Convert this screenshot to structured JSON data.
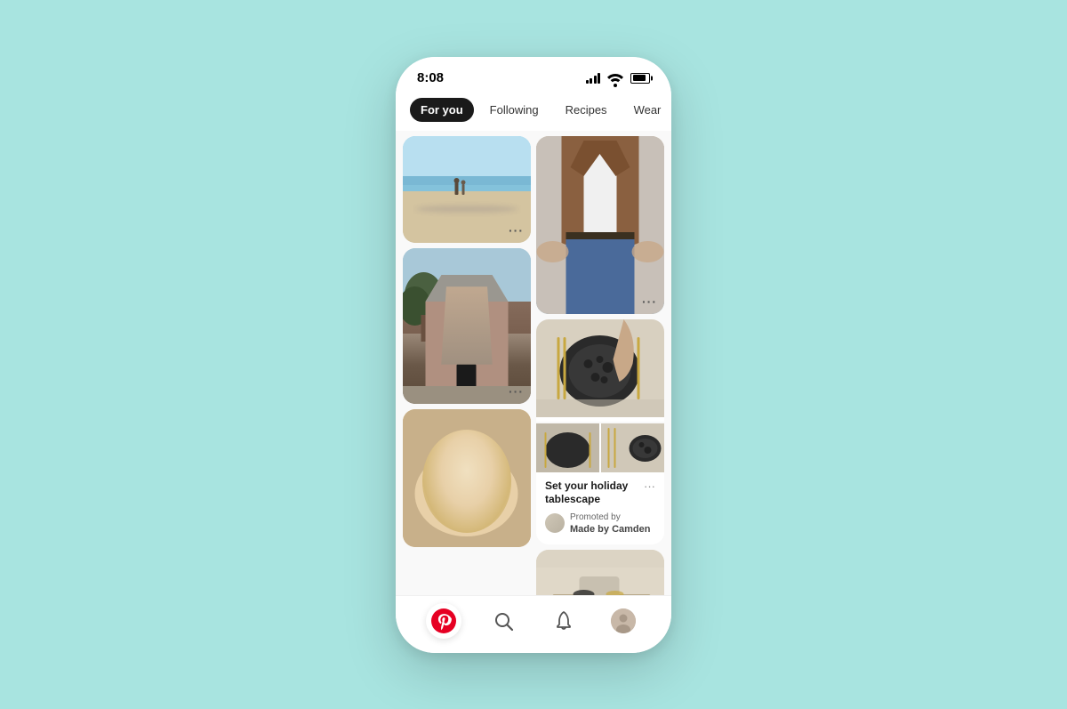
{
  "phone": {
    "status": {
      "time": "8:08"
    },
    "tabs": [
      {
        "id": "for-you",
        "label": "For you",
        "active": true
      },
      {
        "id": "following",
        "label": "Following",
        "active": false
      },
      {
        "id": "recipes",
        "label": "Recipes",
        "active": false
      },
      {
        "id": "wear",
        "label": "Wear",
        "active": false
      }
    ],
    "pins": {
      "left_col": [
        {
          "id": "beach",
          "type": "beach",
          "has_more": true
        },
        {
          "id": "architecture",
          "type": "architecture",
          "has_more": true
        },
        {
          "id": "pie",
          "type": "pie"
        }
      ],
      "right_col": [
        {
          "id": "fashion",
          "type": "fashion",
          "has_more": true
        },
        {
          "id": "tablescape",
          "type": "tablescape",
          "title": "Set your holiday tablescape",
          "promoted": true,
          "promoted_by": "Made by Camden",
          "has_more": true
        },
        {
          "id": "room",
          "type": "room"
        }
      ]
    },
    "nav": {
      "items": [
        {
          "id": "home",
          "icon": "pinterest-icon",
          "active": true
        },
        {
          "id": "search",
          "icon": "search-icon",
          "active": false
        },
        {
          "id": "notifications",
          "icon": "bell-icon",
          "active": false
        },
        {
          "id": "profile",
          "icon": "avatar-icon",
          "active": false
        }
      ]
    }
  },
  "colors": {
    "bg": "#a8e4e0",
    "active_tab_bg": "#1a1a1a",
    "active_tab_text": "#ffffff",
    "pinterest_red": "#e60023"
  }
}
